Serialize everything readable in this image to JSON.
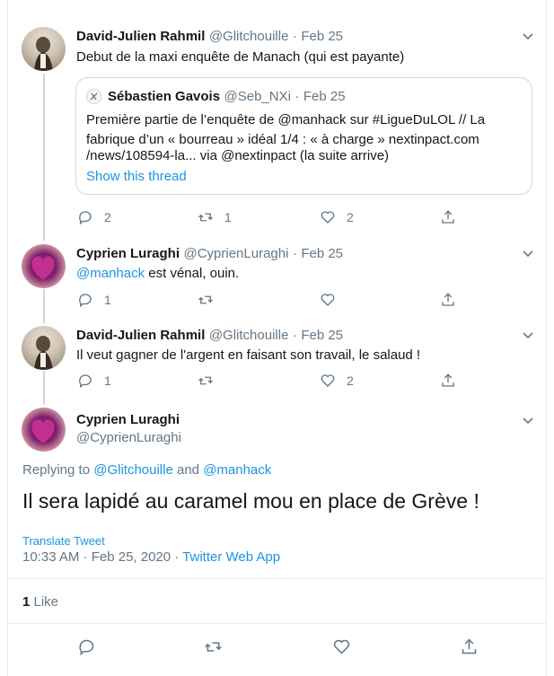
{
  "tweets": [
    {
      "name": "David-Julien Rahmil",
      "handle": "@Glitchouille",
      "dot": "·",
      "date": "Feb 25",
      "text": "Debut de la maxi enquête de Manach (qui est payante)",
      "quote": {
        "name": "Sébastien Gavois",
        "handle": "@Seb_NXi",
        "dot": "·",
        "date": "Feb 25",
        "lines": [
          "Première partie de l’enquête de @manhack sur #LigueDuLOL // La",
          "fabrique d’un « bourreau » idéal 1/4 : « à charge » nextinpact.com",
          "/news/108594-la... via @nextinpact (la suite arrive)"
        ],
        "show_thread": "Show this thread"
      },
      "replies": "2",
      "retweets": "1",
      "likes": "2"
    },
    {
      "name": "Cyprien Luraghi",
      "handle": "@CyprienLuraghi",
      "dot": "·",
      "date": "Feb 25",
      "mention": "@manhack",
      "text": " est vénal, ouin.",
      "replies": "1"
    },
    {
      "name": "David-Julien Rahmil",
      "handle": "@Glitchouille",
      "dot": "·",
      "date": "Feb 25",
      "text": "Il veut gagner de l'argent en faisant son travail, le salaud !",
      "replies": "1",
      "likes": "2"
    }
  ],
  "focus": {
    "name": "Cyprien Luraghi",
    "handle": "@CyprienLuraghi",
    "replying_prefix": "Replying to ",
    "replying_user1": "@Glitchouille",
    "replying_and": " and ",
    "replying_user2": "@manhack",
    "text": "Il sera lapidé au caramel mou en place de Grève !",
    "translate": "Translate Tweet",
    "timestamp": "10:33 AM · Feb 25, 2020 · ",
    "source": "Twitter Web App",
    "like_count": "1",
    "like_label": " Like"
  },
  "colors": {
    "link": "#1b95e0",
    "secondary": "#657786",
    "border": "#e6ecf0"
  }
}
